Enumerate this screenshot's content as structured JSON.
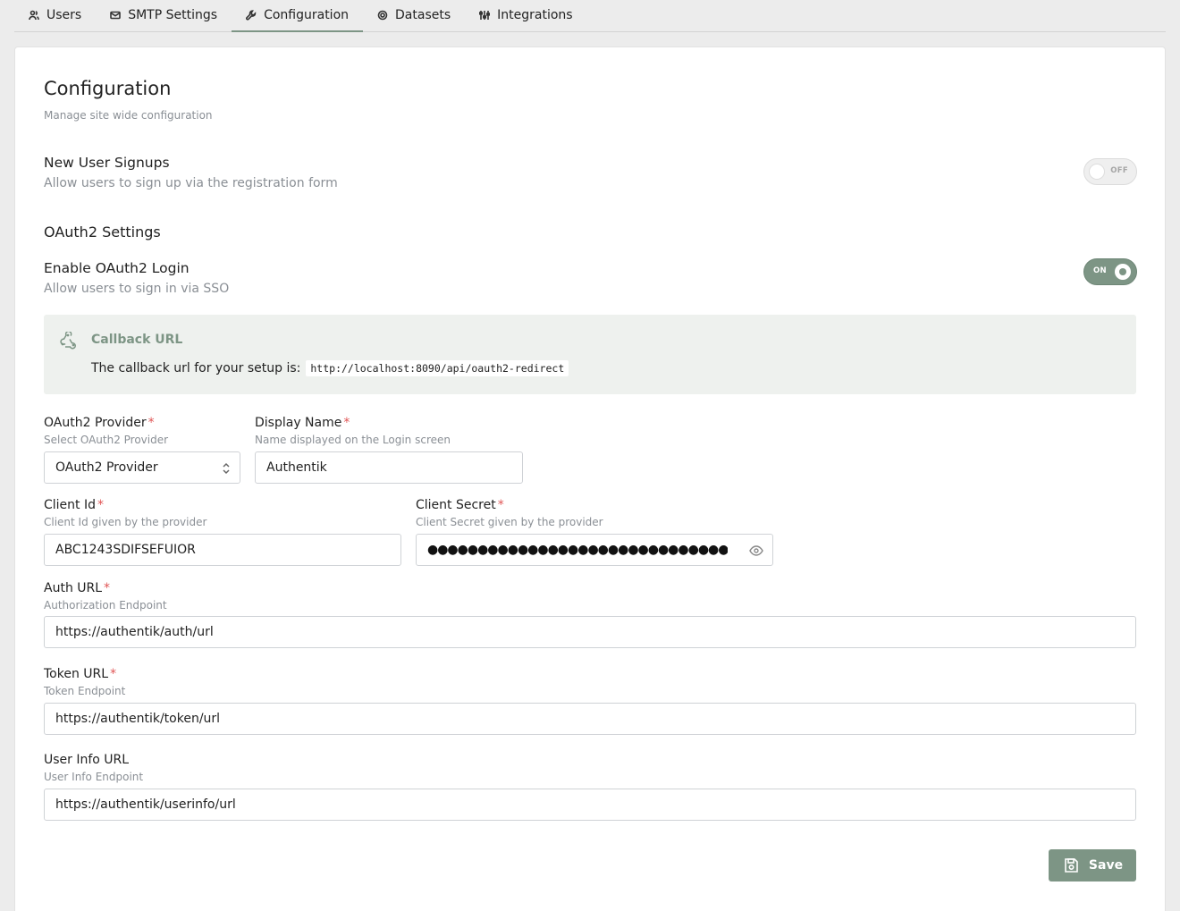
{
  "tabs": [
    {
      "label": "Users",
      "icon": "users-icon"
    },
    {
      "label": "SMTP Settings",
      "icon": "mail-icon"
    },
    {
      "label": "Configuration",
      "icon": "wrench-icon",
      "active": true
    },
    {
      "label": "Datasets",
      "icon": "database-icon"
    },
    {
      "label": "Integrations",
      "icon": "adjustments-icon"
    }
  ],
  "page": {
    "title": "Configuration",
    "subtitle": "Manage site wide configuration"
  },
  "signups": {
    "title": "New User Signups",
    "description": "Allow users to sign up via the registration form",
    "toggle_label": "OFF",
    "enabled": false
  },
  "oauth": {
    "section_title": "OAuth2 Settings",
    "enable_title": "Enable OAuth2 Login",
    "enable_description": "Allow users to sign in via SSO",
    "toggle_label": "ON",
    "enabled": true,
    "callback": {
      "title": "Callback URL",
      "text": "The callback url for your setup is:",
      "url": "http://localhost:8090/api/oauth2-redirect"
    },
    "fields": {
      "provider": {
        "label": "OAuth2 Provider",
        "hint": "Select OAuth2 Provider",
        "value": "OAuth2 Provider"
      },
      "display_name": {
        "label": "Display Name",
        "hint": "Name displayed on the Login screen",
        "value": "Authentik"
      },
      "client_id": {
        "label": "Client Id",
        "hint": "Client Id given by the provider",
        "value": "ABC1243SDIFSEFUIOR"
      },
      "client_secret": {
        "label": "Client Secret",
        "hint": "Client Secret given by the provider",
        "value": "●●●●●●●●●●●●●●●●●●●●●●●●●●●●●●"
      },
      "auth_url": {
        "label": "Auth URL",
        "hint": "Authorization Endpoint",
        "value": "https://authentik/auth/url"
      },
      "token_url": {
        "label": "Token URL",
        "hint": "Token Endpoint",
        "value": "https://authentik/token/url"
      },
      "userinfo_url": {
        "label": "User Info URL",
        "hint": "User Info Endpoint",
        "value": "https://authentik/userinfo/url"
      }
    },
    "required_marker": "*"
  },
  "save_label": "Save",
  "colors": {
    "accent": "#7d9585",
    "required": "#e05555"
  }
}
